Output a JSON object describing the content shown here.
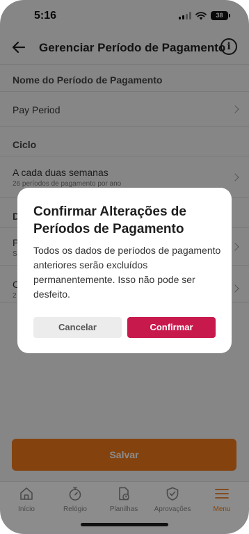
{
  "status": {
    "time": "5:16",
    "battery": "38"
  },
  "header": {
    "title": "Gerenciar Período de Pagamento",
    "info": "i"
  },
  "sections": {
    "name_label": "Nome do Período de Pagamento",
    "name_value": "Pay Period",
    "cycle_label": "Ciclo",
    "cycle_value": "A cada duas semanas",
    "cycle_sub": "26 períodos de pagamento por ano",
    "hidden_label_initial": "D",
    "hidden_row1_initial": "P",
    "hidden_row1_sub_initial": "S",
    "hidden_row2_initial": "C",
    "hidden_row2_sub_initial": "2"
  },
  "save_label": "Salvar",
  "tabs": [
    {
      "label": "Início",
      "icon": "home-icon"
    },
    {
      "label": "Relógio",
      "icon": "stopwatch-icon"
    },
    {
      "label": "Planilhas",
      "icon": "timesheet-icon"
    },
    {
      "label": "Aprovações",
      "icon": "shield-check-icon"
    },
    {
      "label": "Menu",
      "icon": "menu-icon"
    }
  ],
  "dialog": {
    "title": "Confirmar Alterações de Períodos de Pagamento",
    "body": "Todos os dados de períodos de pagamento anteriores serão excluídos permanentemente. Isso não pode ser desfeito.",
    "cancel_label": "Cancelar",
    "confirm_label": "Confirmar"
  },
  "colors": {
    "accent": "#f07a1a",
    "confirm": "#c8194d"
  }
}
